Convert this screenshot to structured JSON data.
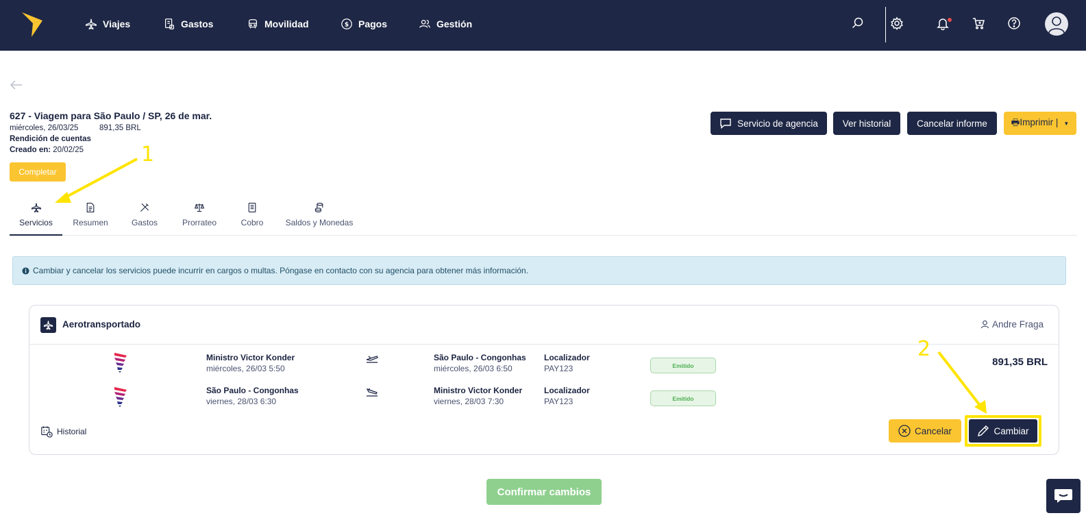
{
  "nav": {
    "items": [
      {
        "label": "Viajes",
        "icon": "plane-icon"
      },
      {
        "label": "Gastos",
        "icon": "receipt-icon"
      },
      {
        "label": "Movilidad",
        "icon": "car-icon"
      },
      {
        "label": "Pagos",
        "icon": "dollar-icon"
      },
      {
        "label": "Gestión",
        "icon": "users-icon"
      }
    ],
    "right_icons": [
      "search-icon",
      "gear-icon",
      "bell-icon",
      "cart-icon",
      "help-icon",
      "avatar-icon"
    ]
  },
  "report": {
    "title": "627 - Viagem para São Paulo / SP, 26 de mar.",
    "date": "miércoles, 26/03/25",
    "amount": "891,35 BRL",
    "type": "Rendición de cuentas",
    "created_label": "Creado en:",
    "created_value": "20/02/25",
    "complete_label": "Completar"
  },
  "actions": {
    "agency": "Servicio de agencia",
    "history": "Ver historial",
    "cancel_report": "Cancelar informe",
    "print": "🖶Imprimir |"
  },
  "tabs": [
    {
      "label": "Servicios",
      "icon": "plane-icon"
    },
    {
      "label": "Resumen",
      "icon": "document-icon"
    },
    {
      "label": "Gastos",
      "icon": "utensils-icon"
    },
    {
      "label": "Prorrateo",
      "icon": "scale-icon"
    },
    {
      "label": "Cobro",
      "icon": "invoice-icon"
    },
    {
      "label": "Saldos y Monedas",
      "icon": "coins-icon"
    }
  ],
  "alert": {
    "text": "Cambiar y cancelar los servicios puede incurrir en cargos o multas. Póngase en contacto con su agencia para obtener más información."
  },
  "service": {
    "title": "Aerotransportado",
    "traveler": "Andre Fraga",
    "price": "891,35 BRL",
    "segments": [
      {
        "origin": "Ministro Victor Konder",
        "origin_time": "miércoles, 26/03 5:50",
        "destination": "São Paulo - Congonhas",
        "destination_time": "miércoles, 26/03 6:50",
        "locator_label": "Localizador",
        "locator": "PAY123",
        "status": "Emitido"
      },
      {
        "origin": "São Paulo - Congonhas",
        "origin_time": "viernes, 28/03 6:30",
        "destination": "Ministro Victor Konder",
        "destination_time": "viernes, 28/03 7:30",
        "locator_label": "Localizador",
        "locator": "PAY123",
        "status": "Emitido"
      }
    ],
    "history_label": "Historial",
    "cancel_label": "Cancelar",
    "change_label": "Cambiar"
  },
  "confirm_label": "Confirmar cambios",
  "annotations": [
    "1",
    "2"
  ],
  "colors": {
    "navy": "#1e2745",
    "yellow": "#fbc531",
    "highlight": "#ffe400",
    "status_green": "#4caf50"
  }
}
